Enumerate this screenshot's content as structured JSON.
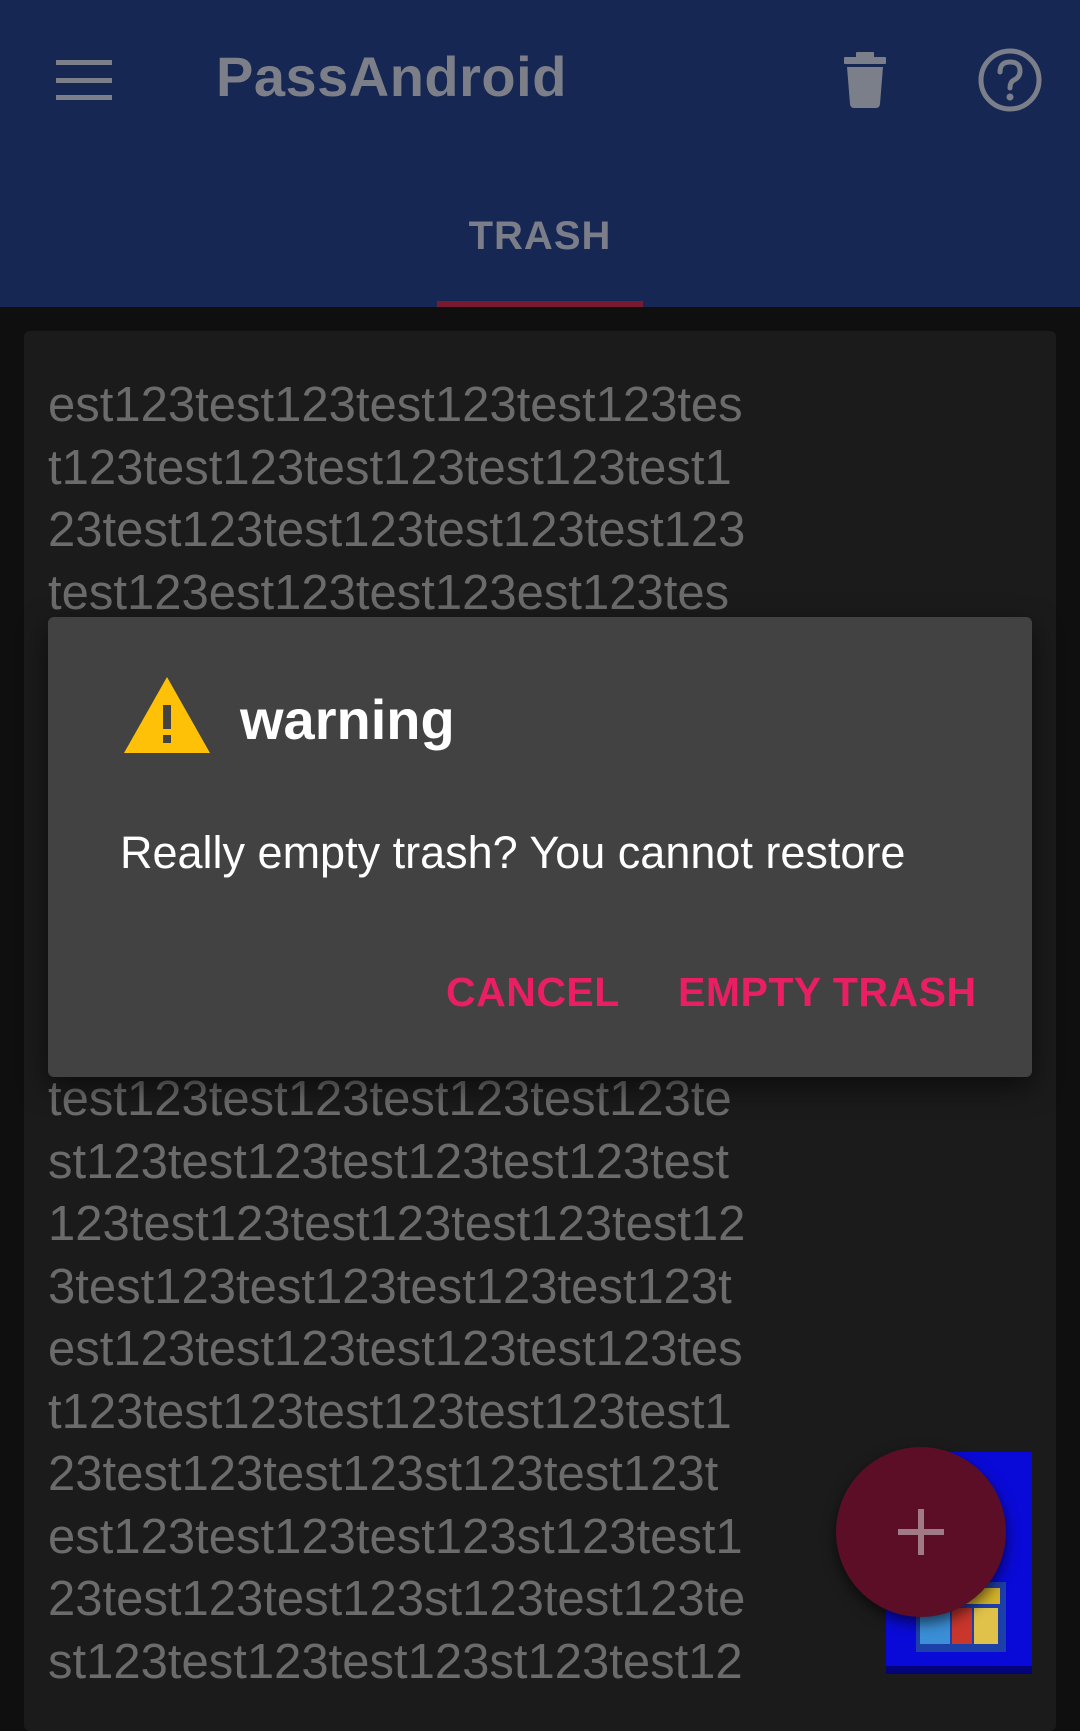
{
  "app_bar": {
    "title": "PassAndroid",
    "menu_icon": "menu-icon",
    "delete_icon": "trash-icon",
    "help_icon": "help-circle-icon",
    "background": "#162754"
  },
  "tabs": [
    {
      "label": "TRASH",
      "selected": true
    }
  ],
  "card": {
    "text_top": "est123test123test123test123tes\nt123test123test123test123test1\n23test123test123test123test123\ntest123est123test123est123tes",
    "text_bottom": "test123test123test123test123te\nst123test123test123test123test\n123test123test123test123test12\n3test123test123test123test123t\nest123test123test123test123tes\nt123test123test123test123test1\n23test123test123st123test123t\nest123test123test123st123test1\n23test123test123st123test123te\nst123test123test123st123test12"
  },
  "dialog": {
    "icon": "warning-icon",
    "title": "warning",
    "message": "Really empty trash? You cannot restore",
    "cancel_label": "CANCEL",
    "confirm_label": "EMPTY TRASH",
    "accent": "#e91e63"
  },
  "fab": {
    "icon": "plus-icon",
    "color": "#5c0e26"
  }
}
